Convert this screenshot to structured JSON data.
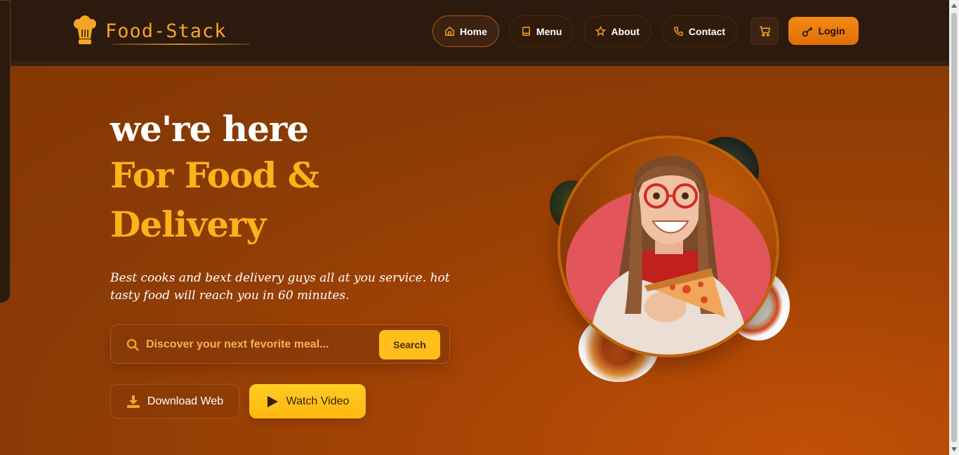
{
  "brand": {
    "name": "Food-Stack",
    "accent": "#f5a524"
  },
  "nav": {
    "items": [
      {
        "label": "Home",
        "icon": "home-icon",
        "active": true
      },
      {
        "label": "Menu",
        "icon": "book-icon",
        "active": false
      },
      {
        "label": "About",
        "icon": "star-icon",
        "active": false
      },
      {
        "label": "Contact",
        "icon": "phone-icon",
        "active": false
      }
    ],
    "cart_icon": "cart-icon",
    "login_label": "Login",
    "login_icon": "key-icon"
  },
  "hero": {
    "line1": "we're here",
    "line2": "For Food &",
    "line3": "Delivery",
    "subtitle": "Best cooks and bext delivery guys all at you service. hot tasty food will reach you in 60 minutes.",
    "search": {
      "placeholder": "Discover your next fevorite meal...",
      "value": "",
      "button": "Search"
    },
    "download_label": "Download Web",
    "watch_label": "Watch Video",
    "colors": {
      "headline": "#ffffff",
      "highlight": "#ffb21a",
      "button": "#ffbe1a",
      "login": "#f48a14"
    }
  }
}
